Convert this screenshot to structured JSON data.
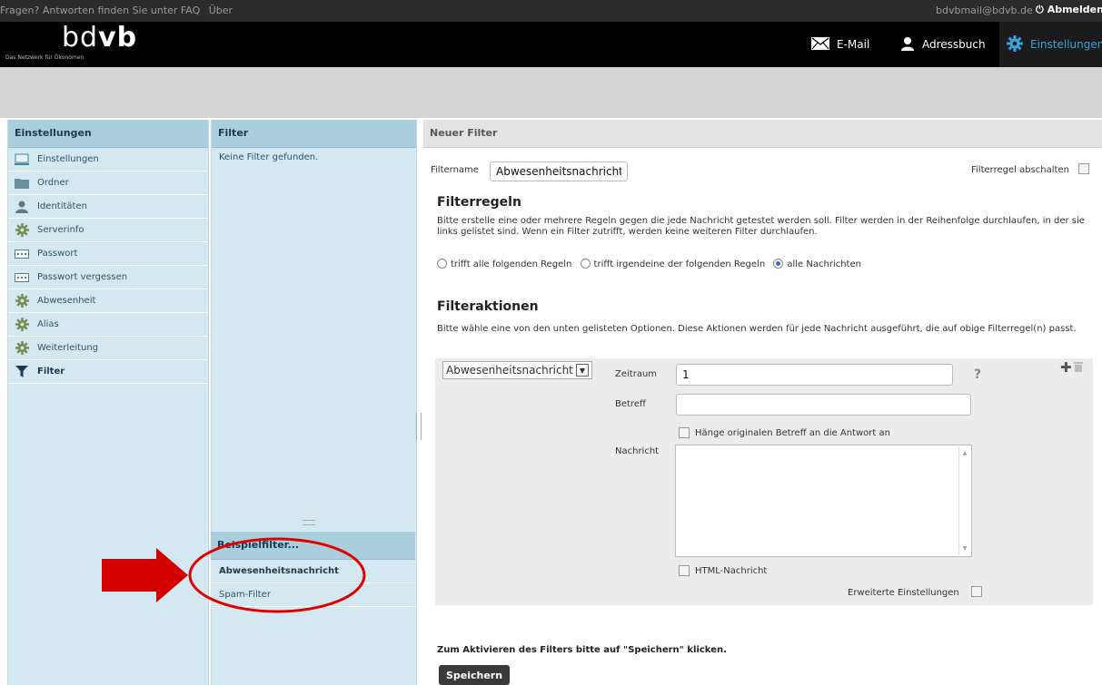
{
  "topbar": {
    "help_text": "Fragen? Antworten finden Sie unter FAQ",
    "about": "Über",
    "user_email": "bdvbmail@bdvb.de",
    "logout": "Abmelden"
  },
  "header": {
    "logo_light": "bd",
    "logo_bold": "vb",
    "tagline": "Das Netzwerk für Ökonomen",
    "nav": {
      "email": "E-Mail",
      "addressbook": "Adressbuch",
      "settings": "Einstellungen"
    }
  },
  "left_panel": {
    "title": "Einstellungen",
    "items": [
      {
        "label": "Einstellungen",
        "icon": "monitor-icon"
      },
      {
        "label": "Ordner",
        "icon": "folder-icon"
      },
      {
        "label": "Identitäten",
        "icon": "user-icon"
      },
      {
        "label": "Serverinfo",
        "icon": "gear-icon"
      },
      {
        "label": "Passwort",
        "icon": "password-icon"
      },
      {
        "label": "Passwort vergessen",
        "icon": "password-icon"
      },
      {
        "label": "Abwesenheit",
        "icon": "gear-icon"
      },
      {
        "label": "Alias",
        "icon": "gear-icon"
      },
      {
        "label": "Weiterleitung",
        "icon": "gear-icon"
      },
      {
        "label": "Filter",
        "icon": "funnel-icon",
        "active": true
      }
    ]
  },
  "filter_panel": {
    "title": "Filter",
    "empty_message": "Keine Filter gefunden.",
    "examples_title": "Beispielfilter...",
    "examples": [
      "Abwesenheitsnachricht",
      "Spam-Filter"
    ]
  },
  "new_filter": {
    "title": "Neuer Filter",
    "name_label": "Filtername",
    "name_value": "Abwesenheitsnachricht",
    "disable_label": "Filterregel abschalten",
    "rules_heading": "Filterregeln",
    "rules_text": "Bitte erstelle eine oder mehrere Regeln gegen die jede Nachricht getestet werden soll. Filter werden in der Reihenfolge durchlaufen, in der sie links gelistet sind. Wenn ein Filter zutrifft, werden keine weiteren Filter durchlaufen.",
    "rule_options": [
      "trifft alle folgenden Regeln",
      "trifft irgendeine der folgenden Regeln",
      "alle Nachrichten"
    ],
    "selected_rule": 2,
    "actions_heading": "Filteraktionen",
    "actions_text": "Bitte wähle eine von den unten gelisteten Optionen. Diese Aktionen werden für jede Nachricht ausgeführt, die auf obige Filterregel(n) passt.",
    "action_select": "Abwesenheitsnachricht",
    "period_label": "Zeitraum",
    "period_value": "1",
    "help_mark": "?",
    "subject_label": "Betreff",
    "subject_value": "",
    "append_subject_label": "Hänge originalen Betreff an die Antwort an",
    "message_label": "Nachricht",
    "html_label": "HTML-Nachricht",
    "advanced_label": "Erweiterte Einstellungen",
    "save_hint": "Zum Aktivieren des Filters bitte auf \"Speichern\" klicken.",
    "save_button": "Speichern"
  },
  "colors": {
    "accent_blue": "#3aa3dd",
    "annotation_red": "#d40000"
  }
}
